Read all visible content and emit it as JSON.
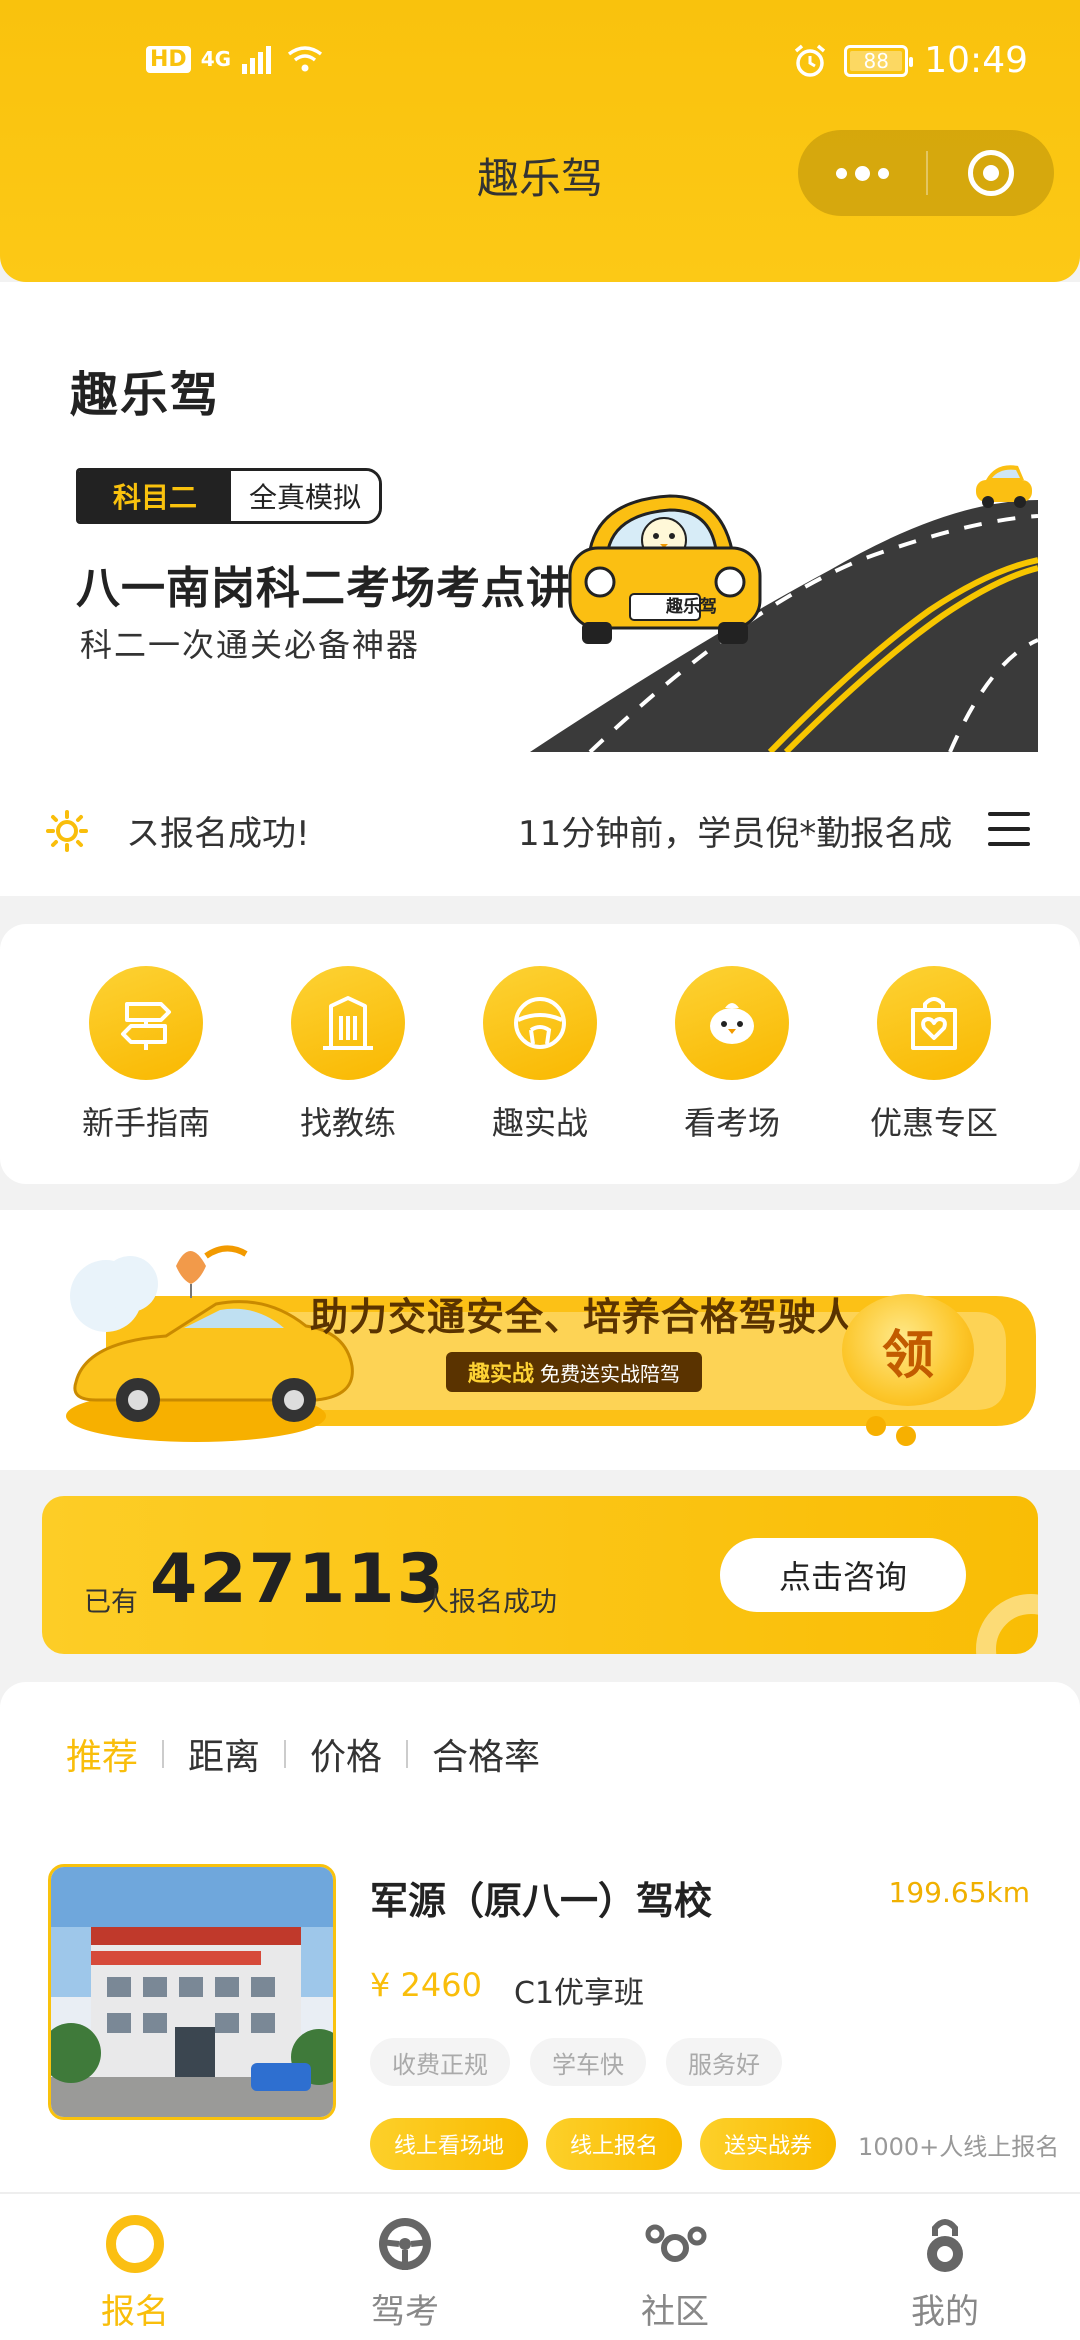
{
  "status_bar": {
    "network": "4G",
    "hd": "HD",
    "battery": "88",
    "time": "10:49"
  },
  "header": {
    "title": "趣乐驾"
  },
  "brand": {
    "logo_text": "趣乐驾"
  },
  "banner": {
    "tag_primary": "科目二",
    "tag_secondary": "全真模拟",
    "title": "八一南岗科二考场考点讲解视频",
    "subtitle": "科二一次通关必备神器",
    "car_plate": "趣乐驾"
  },
  "notice": {
    "text_a": "ス报名成功!",
    "text_b": "11分钟前，学员倪*勤报名成"
  },
  "grid": [
    {
      "label": "新手指南",
      "icon": "signpost-icon"
    },
    {
      "label": "找教练",
      "icon": "building-icon"
    },
    {
      "label": "趣实战",
      "icon": "steering-wheel-icon"
    },
    {
      "label": "看考场",
      "icon": "chick-icon"
    },
    {
      "label": "优惠专区",
      "icon": "shopping-bag-heart-icon"
    }
  ],
  "promo": {
    "headline": "助力交通安全、培养合格驾驶人",
    "badge_brand": "趣实战",
    "badge_text": "免费送实战陪驾",
    "get_label": "领"
  },
  "stats": {
    "prefix": "已有",
    "count": "427113",
    "suffix": "人报名成功",
    "consult_label": "点击咨询"
  },
  "sort_tabs": [
    {
      "label": "推荐",
      "active": true
    },
    {
      "label": "距离",
      "active": false
    },
    {
      "label": "价格",
      "active": false
    },
    {
      "label": "合格率",
      "active": false
    }
  ],
  "school": {
    "name": "军源（原八一）驾校",
    "distance": "199.65km",
    "price": "¥ 2460",
    "class_name": "C1优享班",
    "features": [
      "收费正规",
      "学车快",
      "服务好"
    ],
    "actions": [
      "线上看场地",
      "线上报名",
      "送实战券"
    ],
    "online_count": "1000+人线上报名"
  },
  "tab_bar": [
    {
      "label": "报名",
      "icon": "ring-icon",
      "active": true
    },
    {
      "label": "驾考",
      "icon": "steering-wheel-icon",
      "active": false
    },
    {
      "label": "社区",
      "icon": "bubbles-icon",
      "active": false
    },
    {
      "label": "我的",
      "icon": "lock-person-icon",
      "active": false
    }
  ],
  "colors": {
    "brand": "#f9c20d",
    "accent_text": "#f9be0b",
    "dark": "#222222"
  }
}
